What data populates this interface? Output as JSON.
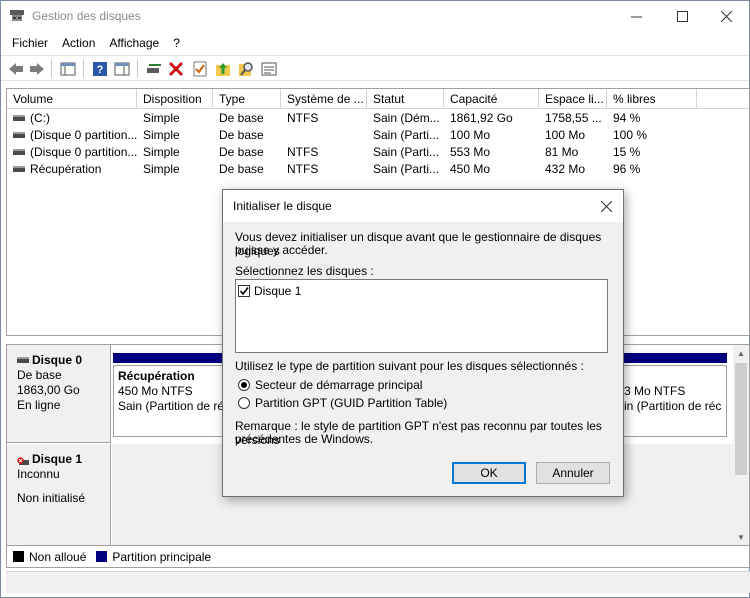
{
  "window": {
    "title": "Gestion des disques",
    "controls": {
      "minimize": "—",
      "maximize": "☐",
      "close": "✕"
    }
  },
  "menu": [
    "Fichier",
    "Action",
    "Affichage",
    "?"
  ],
  "volumes": {
    "columns": [
      "Volume",
      "Disposition",
      "Type",
      "Système de ...",
      "Statut",
      "Capacité",
      "Espace li...",
      "% libres"
    ],
    "rows": [
      [
        "(C:)",
        "Simple",
        "De base",
        "NTFS",
        "Sain (Dém...",
        "1861,92 Go",
        "1758,55 ...",
        "94 %"
      ],
      [
        "(Disque 0 partition...",
        "Simple",
        "De base",
        "",
        "Sain (Parti...",
        "100 Mo",
        "100 Mo",
        "100 %"
      ],
      [
        "(Disque 0 partition...",
        "Simple",
        "De base",
        "NTFS",
        "Sain (Parti...",
        "553 Mo",
        "81 Mo",
        "15 %"
      ],
      [
        "Récupération",
        "Simple",
        "De base",
        "NTFS",
        "Sain (Parti...",
        "450 Mo",
        "432 Mo",
        "96 %"
      ]
    ]
  },
  "disks": {
    "disk0": {
      "name": "Disque 0",
      "type": "De base",
      "size": "1863,00 Go",
      "status": "En ligne",
      "partition_left": {
        "name": "Récupération",
        "size_fs": "450 Mo NTFS",
        "status": "Sain (Partition de réc"
      },
      "partition_right": {
        "size_fs": "3 Mo NTFS",
        "status": "in (Partition de réc"
      }
    },
    "disk1": {
      "name": "Disque 1",
      "type": "Inconnu",
      "status": "Non initialisé"
    }
  },
  "legend": {
    "items": [
      {
        "label": "Non alloué",
        "color": "#000000"
      },
      {
        "label": "Partition principale",
        "color": "#000080"
      }
    ]
  },
  "dialog": {
    "title": "Initialiser le disque",
    "intro_line1": "Vous devez initialiser un disque avant que le gestionnaire de disques logiques",
    "intro_line2": "puisse y accéder.",
    "select_label": "Sélectionnez les disques :",
    "disk_item": "Disque 1",
    "disk_item_checked": true,
    "partition_style_label": "Utilisez le type de partition suivant pour les disques sélectionnés :",
    "option_mbr": "Secteur de démarrage principal",
    "option_gpt": "Partition GPT (GUID Partition Table)",
    "selected_option": "mbr",
    "note_line1": "Remarque : le style de partition GPT n'est pas reconnu par toutes les versions",
    "note_line2": "précédentes de Windows.",
    "ok_label": "OK",
    "cancel_label": "Annuler"
  }
}
